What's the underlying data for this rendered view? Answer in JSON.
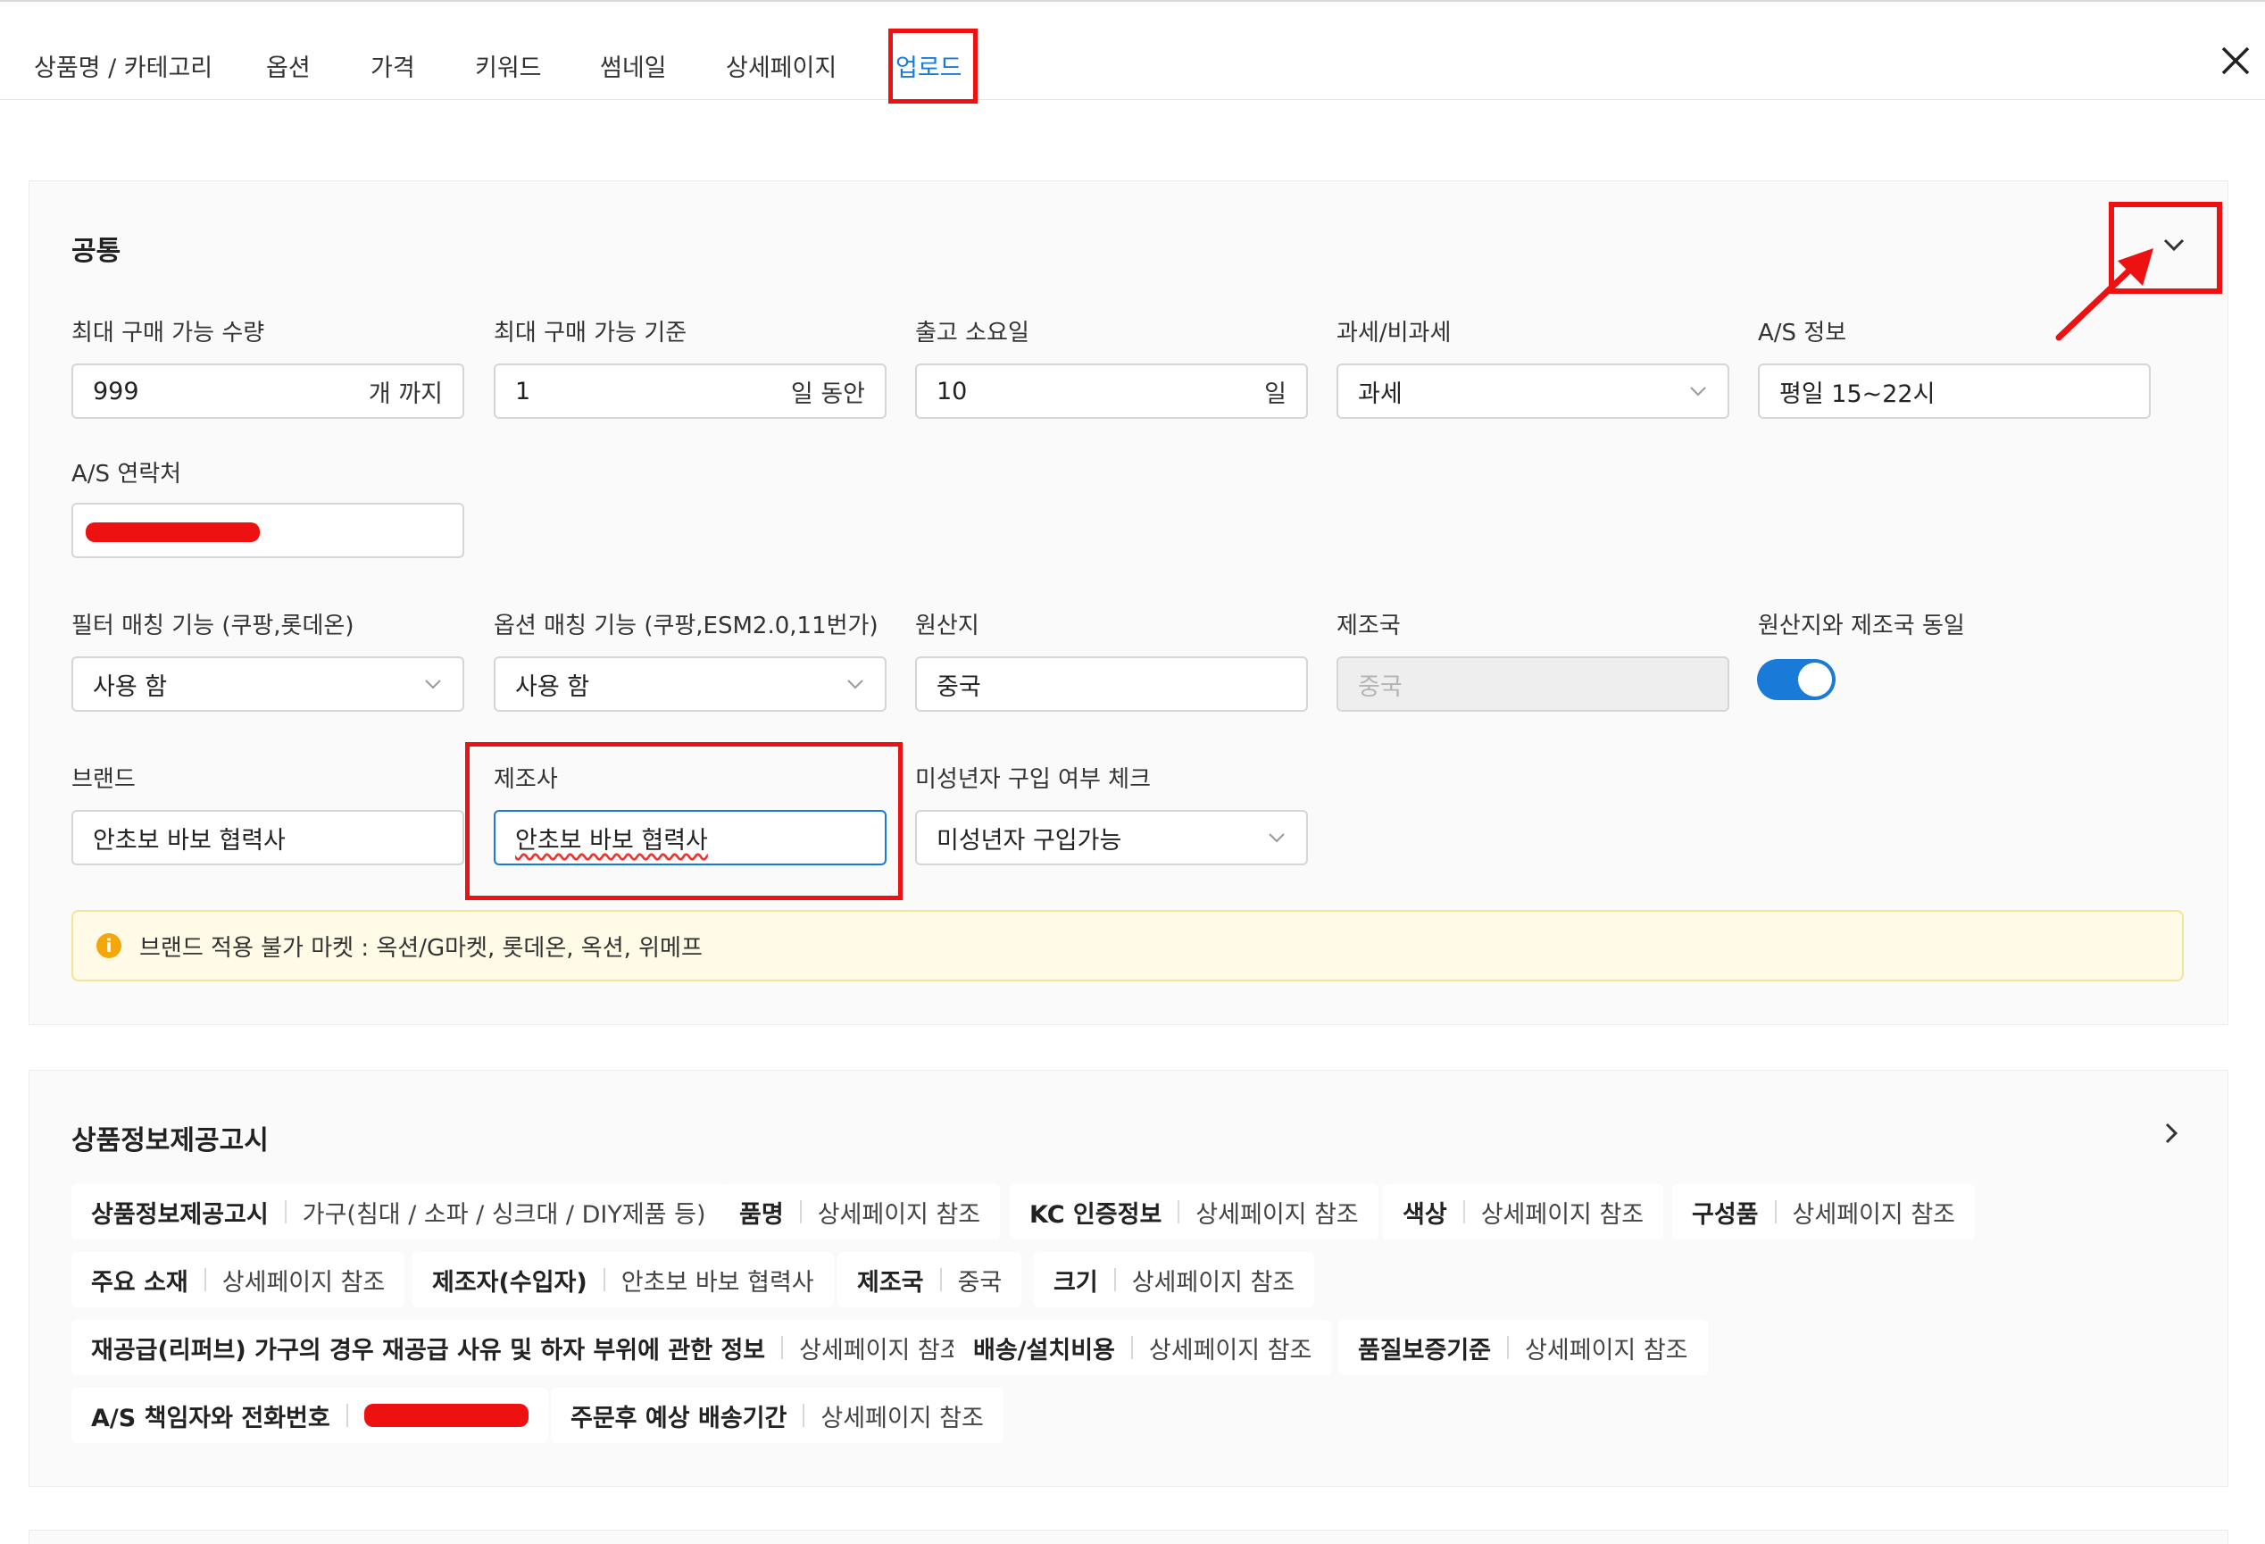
{
  "tabs": [
    {
      "label": "상품명 / 카테고리",
      "active": false
    },
    {
      "label": "옵션",
      "active": false
    },
    {
      "label": "가격",
      "active": false
    },
    {
      "label": "키워드",
      "active": false
    },
    {
      "label": "썸네일",
      "active": false
    },
    {
      "label": "상세페이지",
      "active": false
    },
    {
      "label": "업로드",
      "active": true
    }
  ],
  "common": {
    "title": "공통",
    "max_qty": {
      "label": "최대 구매 가능 수량",
      "value": "999",
      "unit": "개 까지"
    },
    "max_period": {
      "label": "최대 구매 가능 기준",
      "value": "1",
      "unit": "일 동안"
    },
    "ship_days": {
      "label": "출고 소요일",
      "value": "10",
      "unit": "일"
    },
    "tax": {
      "label": "과세/비과세",
      "value": "과세"
    },
    "as_info": {
      "label": "A/S 정보",
      "value": "평일 15~22시"
    },
    "as_contact": {
      "label": "A/S 연락처",
      "redacted": true
    },
    "filter_match": {
      "label": "필터 매칭 기능 (쿠팡,롯데온)",
      "value": "사용 함"
    },
    "option_match": {
      "label": "옵션 매칭 기능 (쿠팡,ESM2.0,11번가)",
      "value": "사용 함"
    },
    "origin": {
      "label": "원산지",
      "value": "중국"
    },
    "maker_country": {
      "label": "제조국",
      "value": "중국",
      "disabled": true
    },
    "same_origin": {
      "label": "원산지와 제조국 동일",
      "on": true
    },
    "brand": {
      "label": "브랜드",
      "value": "안초보 바보 협력사"
    },
    "manufacturer": {
      "label": "제조사",
      "value": "안초보 바보 협력사"
    },
    "minor_check": {
      "label": "미성년자 구입 여부 체크",
      "value": "미성년자 구입가능"
    },
    "notice": "브랜드 적용 불가 마켓 : 옥션/G마켓, 롯데온, 옥션, 위메프"
  },
  "product_info": {
    "title": "상품정보제공고시",
    "rows": [
      [
        {
          "key": "상품정보제공고시",
          "value": "가구(침대 / 소파 / 싱크대 / DIY제품 등)"
        },
        {
          "key": "품명",
          "value": "상세페이지 참조"
        },
        {
          "key": "KC 인증정보",
          "value": "상세페이지 참조"
        },
        {
          "key": "색상",
          "value": "상세페이지 참조"
        },
        {
          "key": "구성품",
          "value": "상세페이지 참조"
        }
      ],
      [
        {
          "key": "주요 소재",
          "value": "상세페이지 참조"
        },
        {
          "key": "제조자(수입자)",
          "value": "안초보 바보 협력사"
        },
        {
          "key": "제조국",
          "value": "중국"
        },
        {
          "key": "크기",
          "value": "상세페이지 참조"
        }
      ],
      [
        {
          "key": "재공급(리퍼브) 가구의 경우 재공급 사유 및 하자 부위에 관한 정보",
          "value": "상세페이지 참조"
        },
        {
          "key": "배송/설치비용",
          "value": "상세페이지 참조"
        },
        {
          "key": "품질보증기준",
          "value": "상세페이지 참조"
        }
      ],
      [
        {
          "key": "A/S 책임자와 전화번호",
          "value": "",
          "redacted": true
        },
        {
          "key": "주문후 예상 배송기간",
          "value": "상세페이지 참조"
        }
      ]
    ]
  },
  "colors": {
    "accent": "#1a7ad8",
    "highlight": "#ee1111",
    "notice_bg": "#fffbe6"
  }
}
